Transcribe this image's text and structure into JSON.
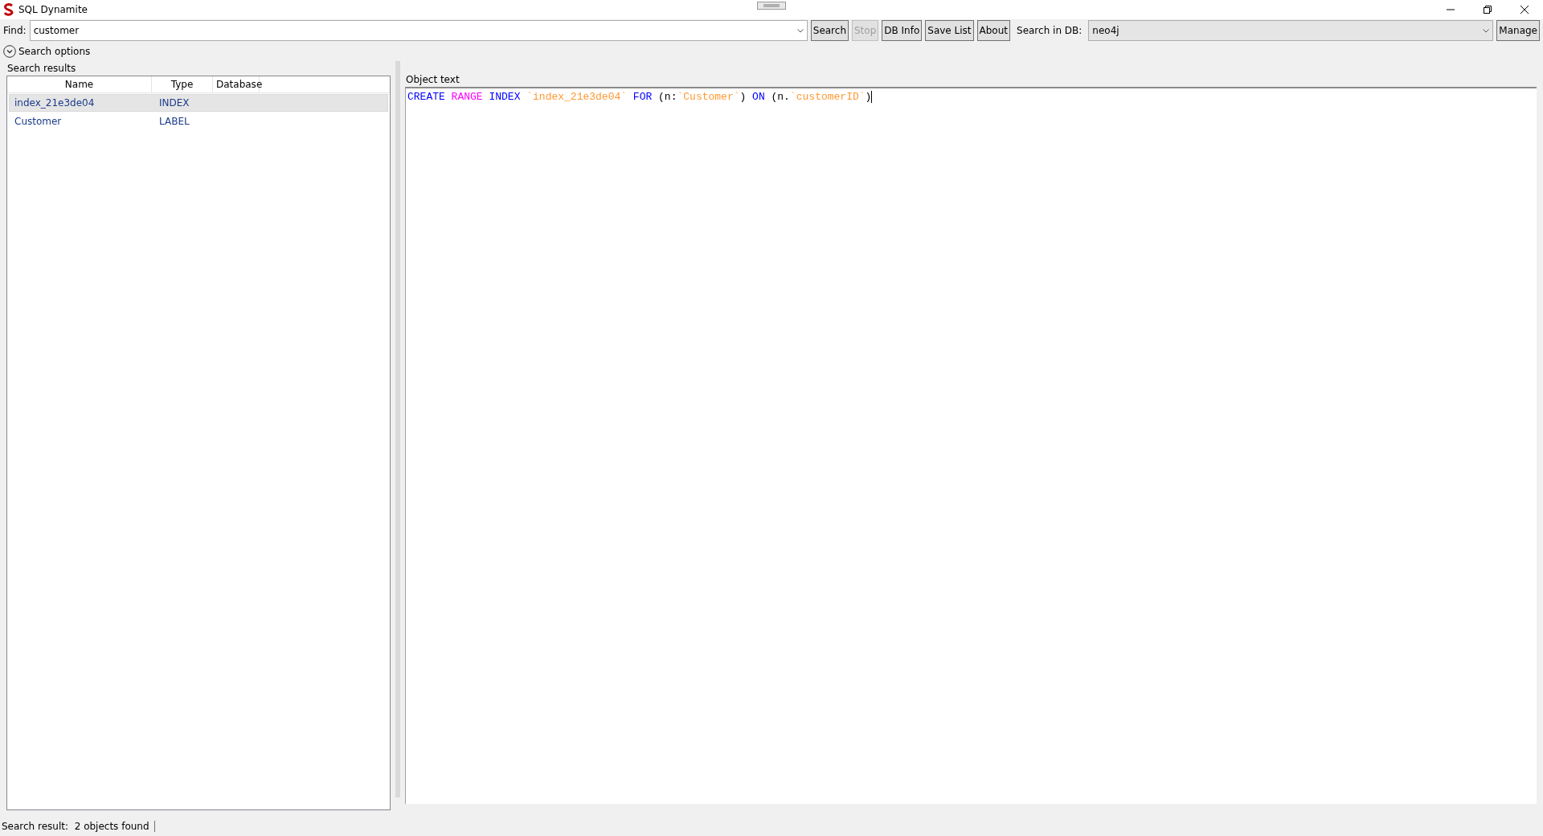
{
  "window": {
    "title": "SQL Dynamite"
  },
  "toolbar": {
    "find_label": "Find:",
    "find_value": "customer",
    "buttons": [
      {
        "label": "Search",
        "disabled": false
      },
      {
        "label": "Stop",
        "disabled": true
      },
      {
        "label": "DB Info",
        "disabled": false
      },
      {
        "label": "Save List",
        "disabled": false
      },
      {
        "label": "About",
        "disabled": false
      }
    ],
    "db_label": "Search in DB:",
    "db_value": "neo4j",
    "manage": "Manage"
  },
  "search_options": {
    "label": "Search options",
    "expanded": false
  },
  "results": {
    "title": "Search results",
    "columns": [
      "Name",
      "Type",
      "Database"
    ],
    "rows": [
      {
        "name": "index_21e3de04",
        "type": "INDEX",
        "selected": true
      },
      {
        "name": "Customer",
        "type": "LABEL",
        "selected": false
      }
    ]
  },
  "object_text": {
    "title": "Object text",
    "tokens": [
      {
        "text": "CREATE ",
        "kind": "keyword"
      },
      {
        "text": "RANGE ",
        "kind": "function"
      },
      {
        "text": "INDEX ",
        "kind": "keyword"
      },
      {
        "text": "`index_21e3de04` ",
        "kind": "string"
      },
      {
        "text": "FOR",
        "kind": "keyword"
      },
      {
        "text": " (n:",
        "kind": "plain"
      },
      {
        "text": "`Customer`",
        "kind": "string"
      },
      {
        "text": ") ",
        "kind": "plain"
      },
      {
        "text": "ON",
        "kind": "keyword"
      },
      {
        "text": " (n.",
        "kind": "plain"
      },
      {
        "text": "`customerID`",
        "kind": "string"
      },
      {
        "text": ")",
        "kind": "plain"
      }
    ]
  },
  "status_bar": {
    "label": "Search result:",
    "value": "2 objects found"
  }
}
